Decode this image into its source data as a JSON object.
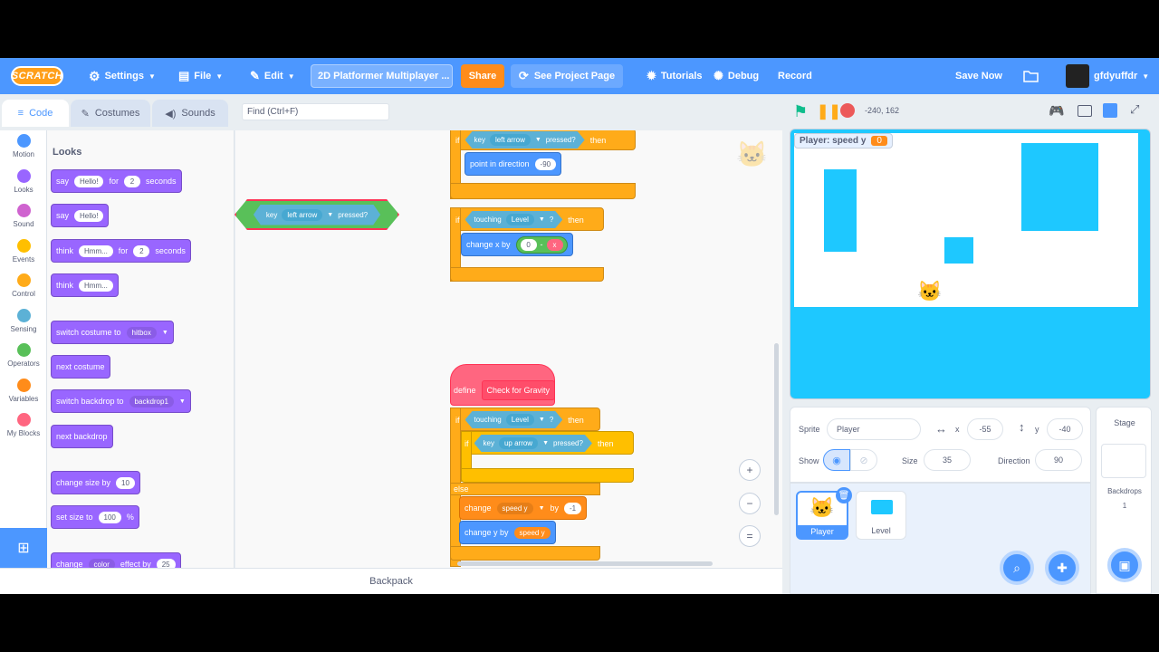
{
  "menubar": {
    "logo": "SCRATCH",
    "settings": "Settings",
    "file": "File",
    "edit": "Edit",
    "project_title": "2D Platformer Multiplayer ...",
    "share": "Share",
    "see_project": "See Project Page",
    "tutorials": "Tutorials",
    "debug": "Debug",
    "record": "Record",
    "save_now": "Save Now",
    "username": "gfdyuffdr"
  },
  "tabs": {
    "code": "Code",
    "costumes": "Costumes",
    "sounds": "Sounds"
  },
  "find": {
    "placeholder": "Find (Ctrl+F)"
  },
  "categories": [
    {
      "label": "Motion",
      "color": "#4c97ff"
    },
    {
      "label": "Looks",
      "color": "#9966ff"
    },
    {
      "label": "Sound",
      "color": "#cf63cf"
    },
    {
      "label": "Events",
      "color": "#ffbf00"
    },
    {
      "label": "Control",
      "color": "#ffab19"
    },
    {
      "label": "Sensing",
      "color": "#5cb1d6"
    },
    {
      "label": "Operators",
      "color": "#59c059"
    },
    {
      "label": "Variables",
      "color": "#ff8c1a"
    },
    {
      "label": "My Blocks",
      "color": "#ff6680"
    }
  ],
  "palette": {
    "heading": "Looks",
    "say_for": {
      "say": "say",
      "msg": "Hello!",
      "for": "for",
      "secs": "2",
      "seconds": "seconds"
    },
    "say": {
      "say": "say",
      "msg": "Hello!"
    },
    "think_for": {
      "think": "think",
      "msg": "Hmm...",
      "for": "for",
      "secs": "2",
      "seconds": "seconds"
    },
    "think": {
      "think": "think",
      "msg": "Hmm..."
    },
    "switch_costume": {
      "text": "switch costume to",
      "value": "hitbox"
    },
    "next_costume": "next costume",
    "switch_backdrop": {
      "text": "switch backdrop to",
      "value": "backdrop1"
    },
    "next_backdrop": "next backdrop",
    "change_size": {
      "text": "change size by",
      "value": "10"
    },
    "set_size": {
      "text": "set size to",
      "value": "100",
      "unit": "%"
    },
    "change_effect": {
      "text": "change",
      "effect": "color",
      "by": "effect by",
      "value": "25"
    }
  },
  "dragged_block": {
    "key": "key",
    "value": "left arrow",
    "pressed": "pressed?"
  },
  "script1": {
    "if": "if",
    "key": "key",
    "key_value": "left arrow",
    "pressed": "pressed?",
    "then": "then",
    "point": "point in direction",
    "direction": "-90"
  },
  "script2": {
    "if": "if",
    "touching": "touching",
    "touching_value": "Level",
    "q": "?",
    "then": "then",
    "change_x": "change x by",
    "zero": "0",
    "minus": "-",
    "x_var": "x"
  },
  "script3": {
    "define": "define",
    "proc_name": "Check for Gravity",
    "if": "if",
    "touching": "touching",
    "touching_value": "Level",
    "q": "?",
    "then": "then",
    "inner_if": "if",
    "key": "key",
    "key_value": "up arrow",
    "pressed": "pressed?",
    "inner_then": "then",
    "else": "else",
    "change": "change",
    "var": "speed y",
    "by": "by",
    "by_value": "-1",
    "change_y": "change y by",
    "speed_y": "speed y"
  },
  "stage_header": {
    "coords": "-240, 162"
  },
  "stage": {
    "monitor_label": "Player: speed y",
    "monitor_value": "0"
  },
  "sprite_info": {
    "sprite_label": "Sprite",
    "sprite_name": "Player",
    "x_label": "x",
    "x_value": "-55",
    "y_label": "y",
    "y_value": "-40",
    "show_label": "Show",
    "size_label": "Size",
    "size_value": "35",
    "direction_label": "Direction",
    "direction_value": "90"
  },
  "sprites": [
    {
      "name": "Player",
      "selected": true
    },
    {
      "name": "Level",
      "selected": false
    }
  ],
  "stage_pane": {
    "title": "Stage",
    "backdrops_label": "Backdrops",
    "backdrops_count": "1"
  },
  "backpack": "Backpack"
}
